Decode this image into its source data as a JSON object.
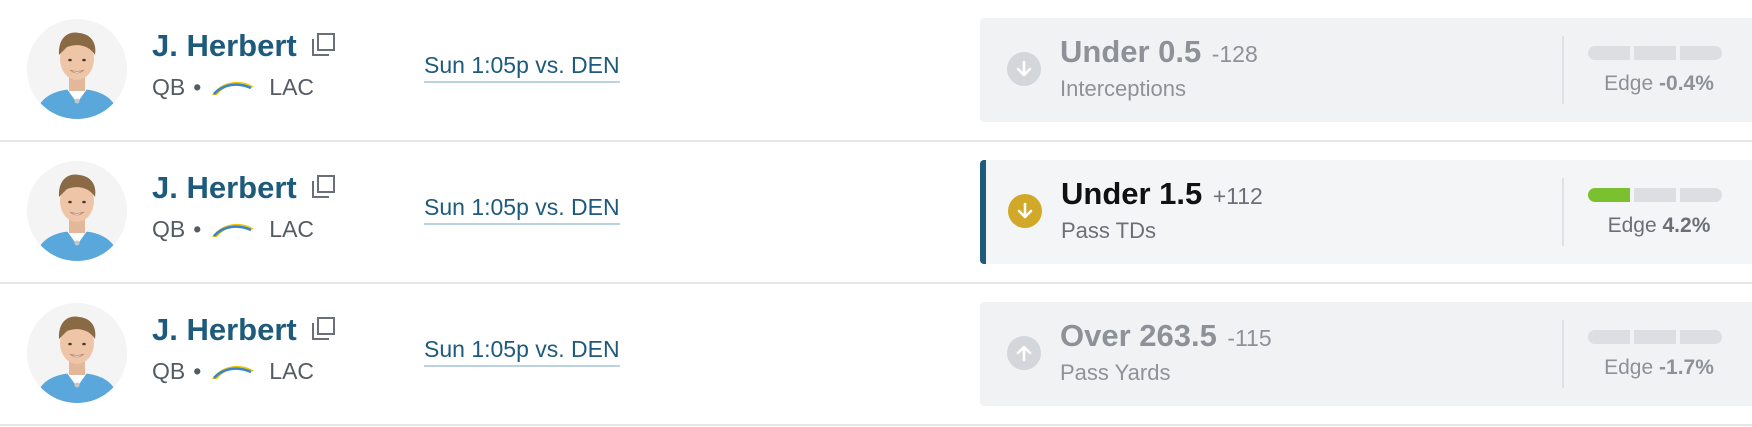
{
  "rows": [
    {
      "player_name": "J. Herbert",
      "position": "QB",
      "separator": "•",
      "team": "LAC",
      "game": "Sun 1:05p vs. DEN",
      "pick_value": "Under 0.5",
      "pick_odds": "-128",
      "pick_stat": "Interceptions",
      "pick_direction": "down",
      "edge_label": "Edge",
      "edge_value": "-0.4%",
      "edge_filled_segments": 0,
      "active": false
    },
    {
      "player_name": "J. Herbert",
      "position": "QB",
      "separator": "•",
      "team": "LAC",
      "game": "Sun 1:05p vs. DEN",
      "pick_value": "Under 1.5",
      "pick_odds": "+112",
      "pick_stat": "Pass TDs",
      "pick_direction": "down",
      "edge_label": "Edge",
      "edge_value": "4.2%",
      "edge_filled_segments": 1,
      "active": true
    },
    {
      "player_name": "J. Herbert",
      "position": "QB",
      "separator": "•",
      "team": "LAC",
      "game": "Sun 1:05p vs. DEN",
      "pick_value": "Over 263.5",
      "pick_odds": "-115",
      "pick_stat": "Pass Yards",
      "pick_direction": "up",
      "edge_label": "Edge",
      "edge_value": "-1.7%",
      "edge_filled_segments": 0,
      "active": false
    }
  ],
  "colors": {
    "name_link": "#1d5a7c",
    "active_bar": "#1d5a7c",
    "active_icon": "#d2a828",
    "edge_positive": "#7ac02f",
    "inactive_gray": "#8d9299"
  },
  "icons": {
    "copy": "copy-icon",
    "team_logo": "chargers-bolt-logo",
    "direction_down": "arrow-down-icon",
    "direction_up": "arrow-up-icon"
  }
}
